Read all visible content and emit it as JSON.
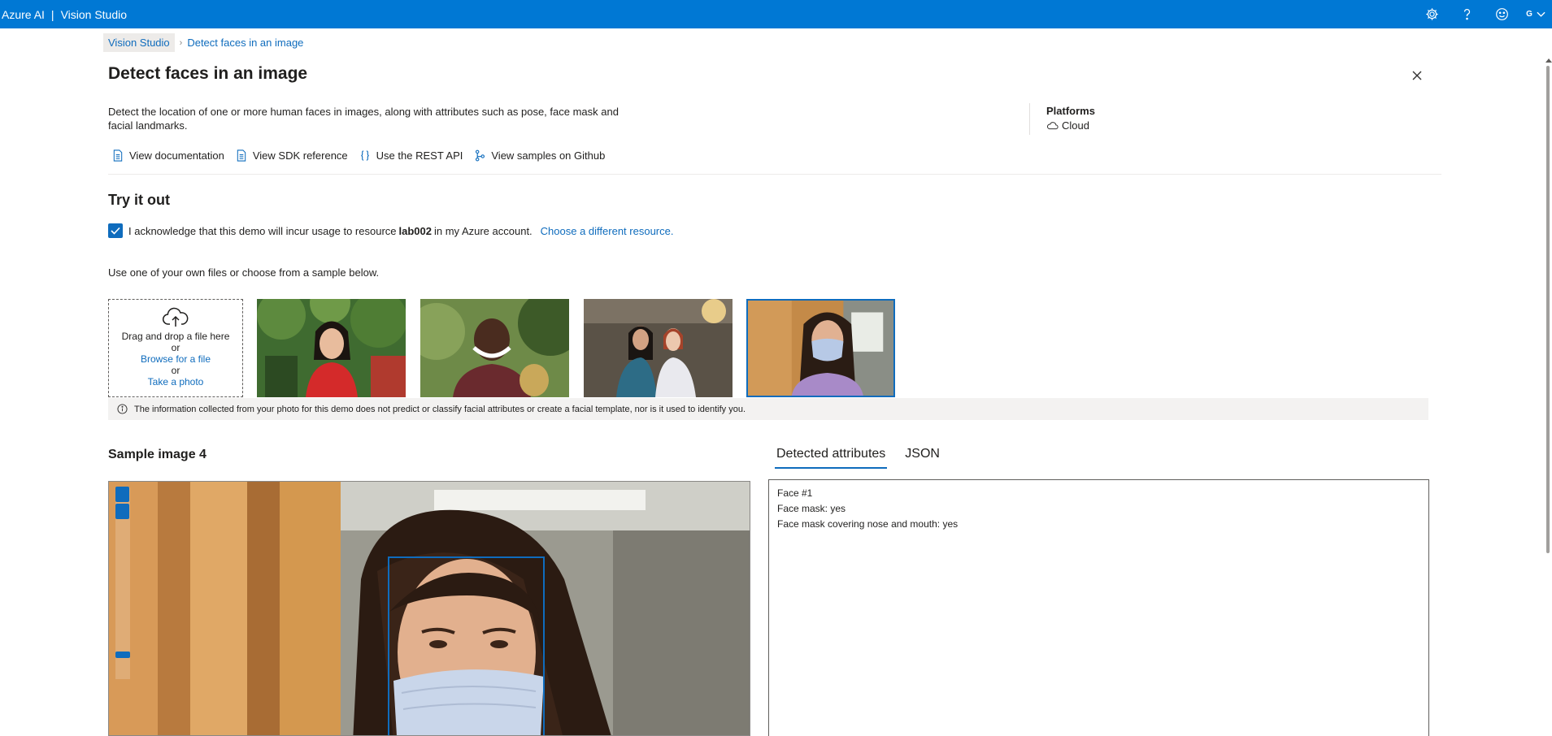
{
  "app": {
    "brand": "Azure AI",
    "separator": "|",
    "product": "Vision Studio",
    "account_initial": "G"
  },
  "breadcrumb": {
    "root": "Vision Studio",
    "current": "Detect faces in an image"
  },
  "page": {
    "title": "Detect faces in an image",
    "description": "Detect the location of one or more human faces in images, along with attributes such as pose, face mask and facial landmarks.",
    "platforms_title": "Platforms",
    "platform": "Cloud"
  },
  "links": {
    "documentation": "View documentation",
    "sdk": "View SDK reference",
    "rest": "Use the REST API",
    "github": "View samples on Github"
  },
  "try_it": {
    "title": "Try it out",
    "ack_prefix": "I acknowledge that this demo will incur usage to resource",
    "resource": "lab002",
    "ack_suffix": "in my Azure account.",
    "choose_resource": "Choose a different resource.",
    "use_own": "Use one of your own files or choose from a sample below."
  },
  "dropzone": {
    "drag": "Drag and drop a file here",
    "or1": "or",
    "browse": "Browse for a file",
    "or2": "or",
    "photo": "Take a photo"
  },
  "info_notice": "The information collected from your photo for this demo does not predict or classify facial attributes or create a facial template, nor is it used to identify you.",
  "result": {
    "sample_title": "Sample image 4",
    "tabs": [
      "Detected attributes",
      "JSON"
    ],
    "active_tab": "Detected attributes",
    "attributes": [
      "Face #1",
      "Face mask: yes",
      "Face mask covering nose and mouth: yes"
    ]
  },
  "colors": {
    "accent": "#0078d4",
    "link": "#0f6cbd"
  }
}
